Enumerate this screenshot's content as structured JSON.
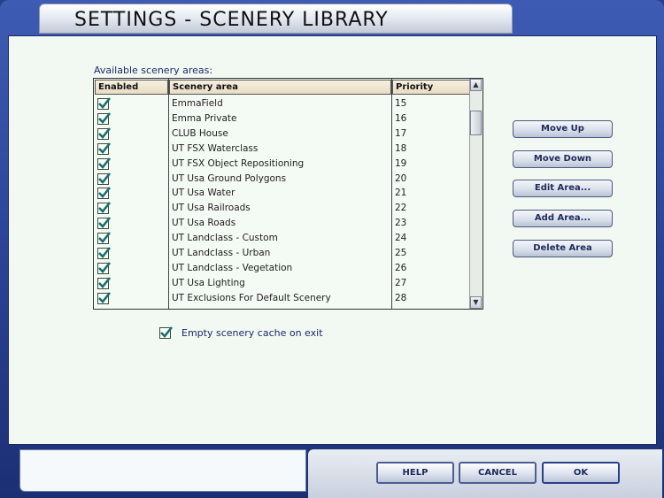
{
  "window": {
    "title": "SETTINGS - SCENERY LIBRARY"
  },
  "list": {
    "label": "Available scenery areas:",
    "headers": {
      "enabled": "Enabled",
      "area": "Scenery area",
      "priority": "Priority"
    },
    "rows": [
      {
        "enabled": true,
        "area": "EmmaField",
        "priority": "15"
      },
      {
        "enabled": true,
        "area": "Emma Private",
        "priority": "16"
      },
      {
        "enabled": true,
        "area": "CLUB House",
        "priority": "17"
      },
      {
        "enabled": true,
        "area": "UT FSX Waterclass",
        "priority": "18"
      },
      {
        "enabled": true,
        "area": "UT FSX Object Repositioning",
        "priority": "19"
      },
      {
        "enabled": true,
        "area": "UT Usa Ground Polygons",
        "priority": "20"
      },
      {
        "enabled": true,
        "area": "UT Usa Water",
        "priority": "21"
      },
      {
        "enabled": true,
        "area": "UT Usa Railroads",
        "priority": "22"
      },
      {
        "enabled": true,
        "area": "UT Usa Roads",
        "priority": "23"
      },
      {
        "enabled": true,
        "area": "UT Landclass - Custom",
        "priority": "24"
      },
      {
        "enabled": true,
        "area": "UT Landclass - Urban",
        "priority": "25"
      },
      {
        "enabled": true,
        "area": "UT Landclass - Vegetation",
        "priority": "26"
      },
      {
        "enabled": true,
        "area": "UT Usa Lighting",
        "priority": "27"
      },
      {
        "enabled": true,
        "area": "UT Exclusions For Default Scenery",
        "priority": "28"
      }
    ]
  },
  "actions": {
    "move_up": "Move Up",
    "move_down": "Move Down",
    "edit_area": "Edit Area...",
    "add_area": "Add Area...",
    "delete_area": "Delete Area"
  },
  "cache_option": {
    "label": "Empty scenery cache on exit",
    "checked": true
  },
  "footer": {
    "help": "HELP",
    "cancel": "CANCEL",
    "ok": "OK"
  },
  "colors": {
    "frame": "#2b4497",
    "content_bg": "#f2f9f2",
    "check": "#1b6e6e"
  },
  "icons": {
    "checkbox": "checkmark-icon",
    "scroll_up": "arrow-up-icon",
    "scroll_down": "arrow-down-icon"
  }
}
